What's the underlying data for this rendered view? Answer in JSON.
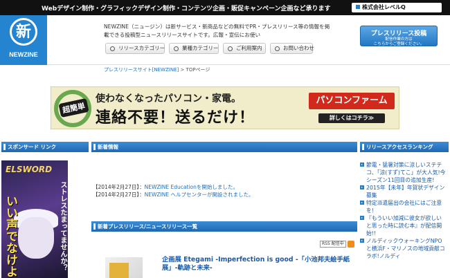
{
  "top_bar": {
    "tagline": "Webデザイン制作・グラフィックデザイン制作・コンテンツ企画・販促キャンペーン企画など承ります",
    "company": "株式会社レベルQ"
  },
  "logo": {
    "mark": "新",
    "name": "NEWZINE"
  },
  "header": {
    "intro": "NEWZINE（ニュージン）は新サービス・新商品などの無料でPR・プレスリリース等の情報を掲載できる投稿型ニュースリリースサイトです。広報・宣伝にお使い",
    "nav": [
      {
        "label": "リリースカテゴリー",
        "icon": "circle-icon"
      },
      {
        "label": "業種カテゴリー",
        "icon": "circle-icon"
      },
      {
        "label": "ご利用案内",
        "icon": "circle-icon"
      },
      {
        "label": "お問い合わせ",
        "icon": "circle-icon"
      }
    ],
    "press_button": {
      "label": "プレスリリース投稿",
      "sub1": "配信作業の方は",
      "sub2": "こちらからご登録ください。"
    }
  },
  "breadcrumb": {
    "link": "プレスリリースサイト[NEWZINE]",
    "sep": " > ",
    "current": "TOPページ"
  },
  "banner": {
    "badge": "超簡単",
    "line1": "使わなくなったパソコン・家電。",
    "line2": "連絡不要！送るだけ！",
    "brand": "パソコンファーム",
    "cta": "詳しくはコチラ≫"
  },
  "sections": {
    "sponsored": "スポンサード リンク",
    "news": "新着情報",
    "releases": "新着プレスリリース/ニュースリリース一覧",
    "ranking": "リリースアクセスランキング"
  },
  "sponsor_ad": {
    "game": "ELSWORD",
    "vertical_text": "ストレスたまってませんか？",
    "big_text": "いい声でなけよ"
  },
  "news": [
    {
      "date": "【2014年2月27日】",
      "sep": "：",
      "text": "NEWZINE Educationを開始しました。"
    },
    {
      "date": "【2014年2月27日】",
      "sep": "：",
      "text": "NEWZINE ヘルプセンターが開設されました。"
    }
  ],
  "rss": {
    "label": "RSS 配信中",
    "icon": "rss-icon"
  },
  "release": {
    "title": "企画展 Etegami -Imperfection is good -「小池邦夫絵手紙展」-軌跡と未来-"
  },
  "ranking": [
    "節電・猛暑対策に涼しいステテコ、「涼(すず)てこ」が大人気!今シーズン11回目の追加生産!",
    "2015年【未年】年賀状デザイン募集",
    "特定派遣届出の会社にはご注意を!",
    "『もういい加減に彼女が欲しいと思った時に読む本』が配信開始!!",
    "ノルディックウォーキングNPOと横浜F・マリノスの地域貢献コラボ!ノルディ"
  ]
}
